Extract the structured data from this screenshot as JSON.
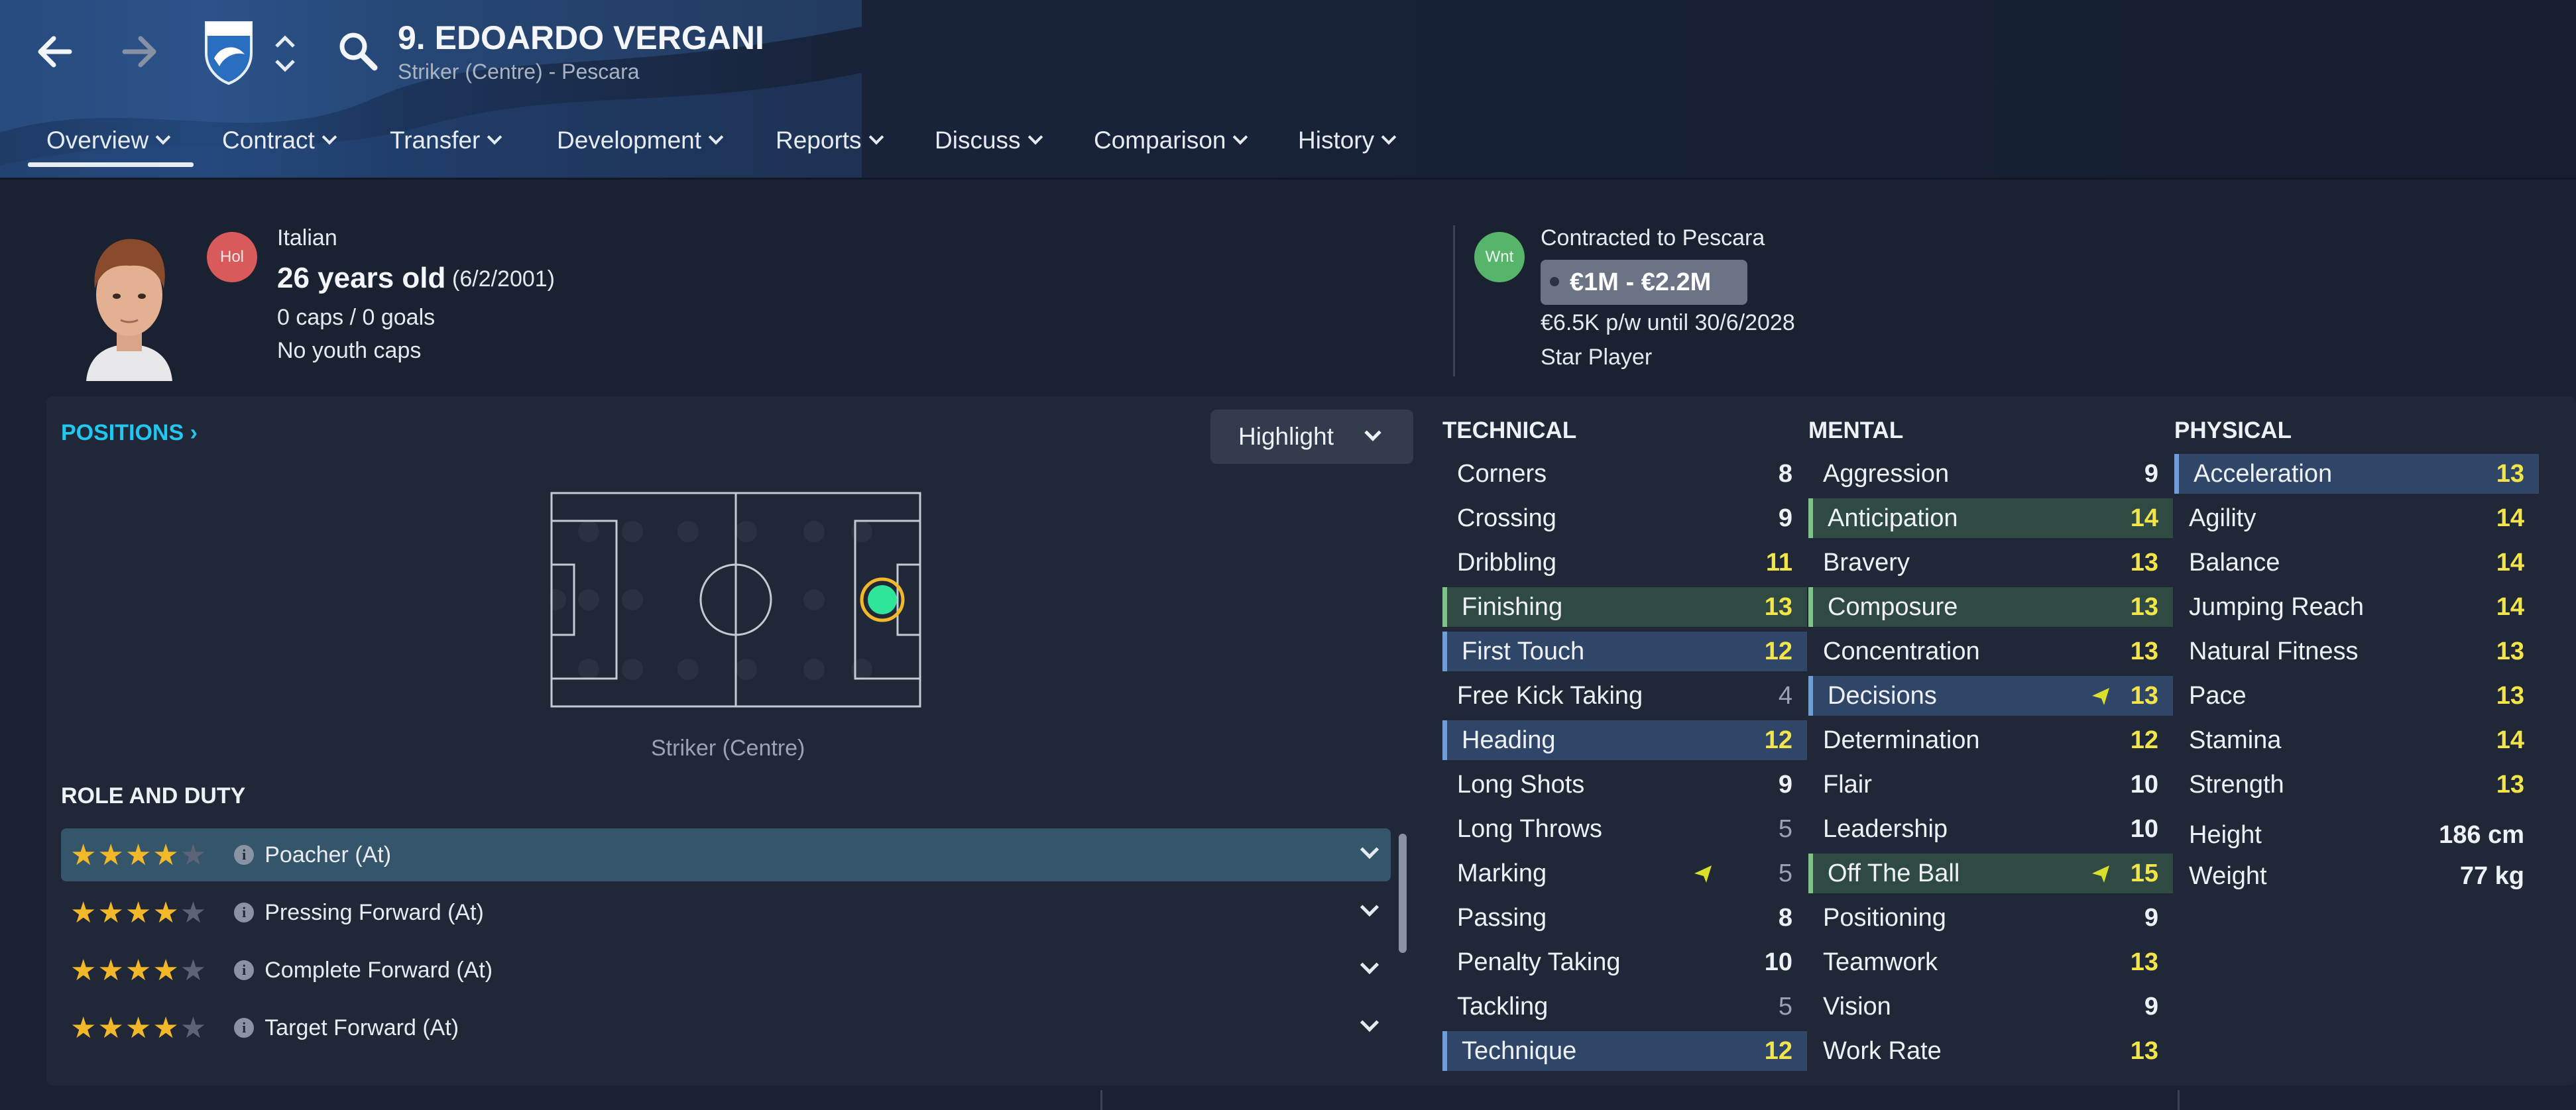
{
  "header": {
    "player_title": "9. EDOARDO VERGANI",
    "player_subtitle": "Striker (Centre) - Pescara",
    "tabs": [
      {
        "label": "Overview"
      },
      {
        "label": "Contract"
      },
      {
        "label": "Transfer"
      },
      {
        "label": "Development"
      },
      {
        "label": "Reports"
      },
      {
        "label": "Discuss"
      },
      {
        "label": "Comparison"
      },
      {
        "label": "History"
      }
    ],
    "icons": [
      "back-arrow-icon",
      "forward-arrow-icon",
      "club-crest-icon",
      "up-down-chevron-icon",
      "search-icon"
    ]
  },
  "profile": {
    "personality_badge": "Hol",
    "nationality": "Italian",
    "age": "26 years old",
    "dob": "(6/2/2001)",
    "caps": "0 caps / 0 goals",
    "youth_caps": "No youth caps",
    "transfer_badge": "Wnt",
    "contract_club": "Contracted to Pescara",
    "value_range": "€1M - €2.2M",
    "wage": "€6.5K p/w until 30/6/2028",
    "squad_status": "Star Player"
  },
  "positions": {
    "title": "POSITIONS",
    "highlight_label": "Highlight",
    "position_label": "Striker (Centre)"
  },
  "roles": {
    "title": "ROLE AND DUTY",
    "items": [
      {
        "name": "Poacher (At)",
        "stars": 4
      },
      {
        "name": "Pressing Forward (At)",
        "stars": 4
      },
      {
        "name": "Complete Forward (At)",
        "stars": 4
      },
      {
        "name": "Target Forward (At)",
        "stars": 4
      }
    ]
  },
  "attributes": {
    "technical": {
      "title": "TECHNICAL",
      "items": [
        {
          "name": "Corners",
          "value": "8"
        },
        {
          "name": "Crossing",
          "value": "9"
        },
        {
          "name": "Dribbling",
          "value": "11"
        },
        {
          "name": "Finishing",
          "value": "13"
        },
        {
          "name": "First Touch",
          "value": "12"
        },
        {
          "name": "Free Kick Taking",
          "value": "4"
        },
        {
          "name": "Heading",
          "value": "12"
        },
        {
          "name": "Long Shots",
          "value": "9"
        },
        {
          "name": "Long Throws",
          "value": "5"
        },
        {
          "name": "Marking",
          "value": "5"
        },
        {
          "name": "Passing",
          "value": "8"
        },
        {
          "name": "Penalty Taking",
          "value": "10"
        },
        {
          "name": "Tackling",
          "value": "5"
        },
        {
          "name": "Technique",
          "value": "12"
        }
      ]
    },
    "mental": {
      "title": "MENTAL",
      "items": [
        {
          "name": "Aggression",
          "value": "9"
        },
        {
          "name": "Anticipation",
          "value": "14"
        },
        {
          "name": "Bravery",
          "value": "13"
        },
        {
          "name": "Composure",
          "value": "13"
        },
        {
          "name": "Concentration",
          "value": "13"
        },
        {
          "name": "Decisions",
          "value": "13"
        },
        {
          "name": "Determination",
          "value": "12"
        },
        {
          "name": "Flair",
          "value": "10"
        },
        {
          "name": "Leadership",
          "value": "10"
        },
        {
          "name": "Off The Ball",
          "value": "15"
        },
        {
          "name": "Positioning",
          "value": "9"
        },
        {
          "name": "Teamwork",
          "value": "13"
        },
        {
          "name": "Vision",
          "value": "9"
        },
        {
          "name": "Work Rate",
          "value": "13"
        }
      ]
    },
    "physical": {
      "title": "PHYSICAL",
      "items": [
        {
          "name": "Acceleration",
          "value": "13"
        },
        {
          "name": "Agility",
          "value": "14"
        },
        {
          "name": "Balance",
          "value": "14"
        },
        {
          "name": "Jumping Reach",
          "value": "14"
        },
        {
          "name": "Natural Fitness",
          "value": "13"
        },
        {
          "name": "Pace",
          "value": "13"
        },
        {
          "name": "Stamina",
          "value": "14"
        },
        {
          "name": "Strength",
          "value": "13"
        }
      ],
      "height_label": "Height",
      "height_value": "186 cm",
      "weight_label": "Weight",
      "weight_value": "77 kg"
    }
  },
  "colors": {
    "accent": "#22c7f0",
    "highlight_value": "#f3e548",
    "key_blue": "#2f4668",
    "key_green": "#2f4a42",
    "star": "#f2b827"
  }
}
